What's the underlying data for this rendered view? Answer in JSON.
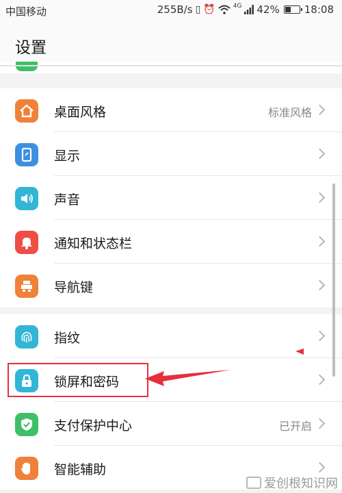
{
  "status_bar": {
    "carrier": "中国移动",
    "speed": "255B/s",
    "network": "4G",
    "battery": "42%",
    "battery_level": 0.42,
    "time": "18:08"
  },
  "header": {
    "title": "设置"
  },
  "groups": [
    {
      "items": [
        {
          "label": "桌面风格",
          "value": "标准风格",
          "icon": "home-icon",
          "color": "#f0813a"
        },
        {
          "label": "显示",
          "value": "",
          "icon": "display-icon",
          "color": "#3d8fe0"
        },
        {
          "label": "声音",
          "value": "",
          "icon": "speaker-icon",
          "color": "#33b5d6"
        },
        {
          "label": "通知和状态栏",
          "value": "",
          "icon": "bell-icon",
          "color": "#ee4e44"
        },
        {
          "label": "导航键",
          "value": "",
          "icon": "navigation-icon",
          "color": "#f0813a"
        }
      ]
    },
    {
      "items": [
        {
          "label": "指纹",
          "value": "",
          "icon": "fingerprint-icon",
          "color": "#33b5d6"
        },
        {
          "label": "锁屏和密码",
          "value": "",
          "icon": "lock-icon",
          "color": "#33b5d6"
        },
        {
          "label": "支付保护中心",
          "value": "已开启",
          "icon": "shield-icon",
          "color": "#3fbf6a"
        },
        {
          "label": "智能辅助",
          "value": "",
          "icon": "hand-icon",
          "color": "#f0813a"
        }
      ]
    }
  ],
  "watermark": "爱创根知识网"
}
